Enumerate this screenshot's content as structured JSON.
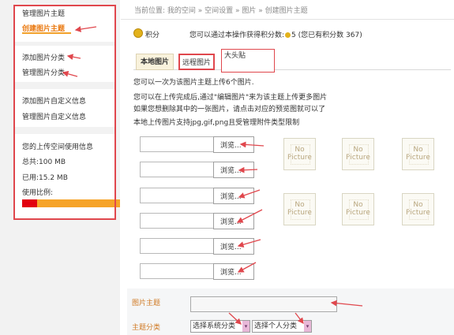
{
  "sidebar": {
    "items": [
      {
        "label": "管理图片主题",
        "active": false
      },
      {
        "label": "创建图片主题",
        "active": true
      },
      {
        "label": "添加图片分类",
        "active": false
      },
      {
        "label": "管理图片分类",
        "active": false
      },
      {
        "label": "添加图片自定义信息",
        "active": false
      },
      {
        "label": "管理图片自定义信息",
        "active": false
      }
    ],
    "usage": {
      "title": "您的上传空间使用信息",
      "total": "总共:100 MB",
      "used": "已用:15.2 MB",
      "ratio_label": "使用比例:",
      "used_fraction": 0.152
    }
  },
  "main": {
    "breadcrumb": "当前位置: 我的空间 » 空间设置 » 图片 » 创建图片主题",
    "points": {
      "label": "积分",
      "text_before": "您可以通过本操作获得积分数:",
      "value": "5",
      "text_after": "(您已有积分数 367)"
    },
    "tabs": [
      {
        "label": "本地图片",
        "active": true
      },
      {
        "label": "远程图片",
        "active": false
      },
      {
        "label": "大头贴",
        "active": false
      }
    ],
    "info_lines": [
      "您可以一次为该图片主题上传6个图片.",
      "您可以在上传完成后,通过\"编辑图片\"来为该主题上传更多图片",
      "如果您想删除其中的一张图片，请点击对应的预览图就可以了",
      "本地上传图片支持jpg,gif,png且受管理附件类型限制"
    ],
    "browse_labels": [
      "浏览...",
      "浏览...",
      "浏览...",
      "浏览...",
      "浏览...",
      "浏览..."
    ],
    "previews": [
      {
        "line1": "No",
        "line2": "Picture"
      },
      {
        "line1": "No",
        "line2": "Picture"
      },
      {
        "line1": "No",
        "line2": "Picture"
      },
      {
        "line1": "No",
        "line2": "Picture"
      },
      {
        "line1": "No",
        "line2": "Picture"
      },
      {
        "line1": "No",
        "line2": "Picture"
      }
    ],
    "topic_label": "图片主题",
    "topic_value": "",
    "category_label": "主题分类",
    "select_system": "选择系统分类",
    "select_personal": "选择个人分类"
  },
  "colors": {
    "accent_orange": "#ea7a12",
    "annotation_red": "#e0474d",
    "usage_bar": "#f6a429",
    "usage_fill": "#e2000e"
  }
}
